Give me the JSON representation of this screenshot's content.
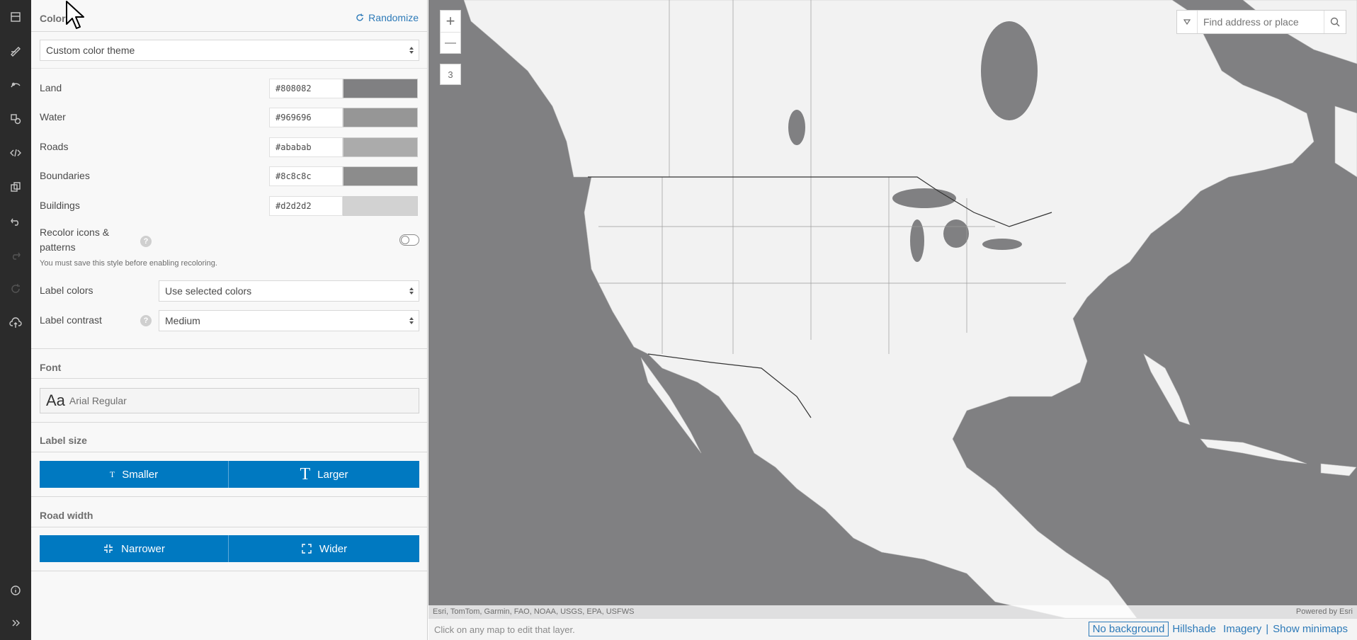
{
  "colors_section": {
    "title": "Colors",
    "randomize_label": "Randomize",
    "theme_select": "Custom color theme",
    "swatches": [
      {
        "label": "Land",
        "hex": "#808082",
        "color": "#808082"
      },
      {
        "label": "Water",
        "hex": "#969696",
        "color": "#969696"
      },
      {
        "label": "Roads",
        "hex": "#ababab",
        "color": "#ababab"
      },
      {
        "label": "Boundaries",
        "hex": "#8c8c8c",
        "color": "#8c8c8c"
      },
      {
        "label": "Buildings",
        "hex": "#d2d2d2",
        "color": "#d2d2d2"
      }
    ],
    "recolor_label": "Recolor icons & patterns",
    "recolor_note": "You must save this style before enabling recoloring.",
    "label_colors_label": "Label colors",
    "label_colors_value": "Use selected colors",
    "label_contrast_label": "Label contrast",
    "label_contrast_value": "Medium",
    "help_glyph": "?"
  },
  "font_section": {
    "title": "Font",
    "sample": "Aa",
    "font_name": "Arial Regular"
  },
  "label_size_section": {
    "title": "Label size",
    "smaller": "Smaller",
    "larger": "Larger",
    "smaller_glyph": "T",
    "larger_glyph": "T"
  },
  "road_width_section": {
    "title": "Road width",
    "narrower": "Narrower",
    "wider": "Wider"
  },
  "map": {
    "zoom_in": "+",
    "zoom_out": "—",
    "zoom_level": "3",
    "search_placeholder": "Find address or place",
    "attribution": "Esri, TomTom, Garmin, FAO, NOAA, USGS, EPA, USFWS",
    "powered_by": "Powered by Esri",
    "land_color": "#f2f2f2",
    "water_color": "#808082"
  },
  "status_bar": {
    "hint": "Click on any map to edit that layer.",
    "no_background": "No background",
    "hillshade": "Hillshade",
    "imagery": "Imagery",
    "show_minimaps": "Show minimaps",
    "separator": "|"
  },
  "accent_color": "#0079c1"
}
